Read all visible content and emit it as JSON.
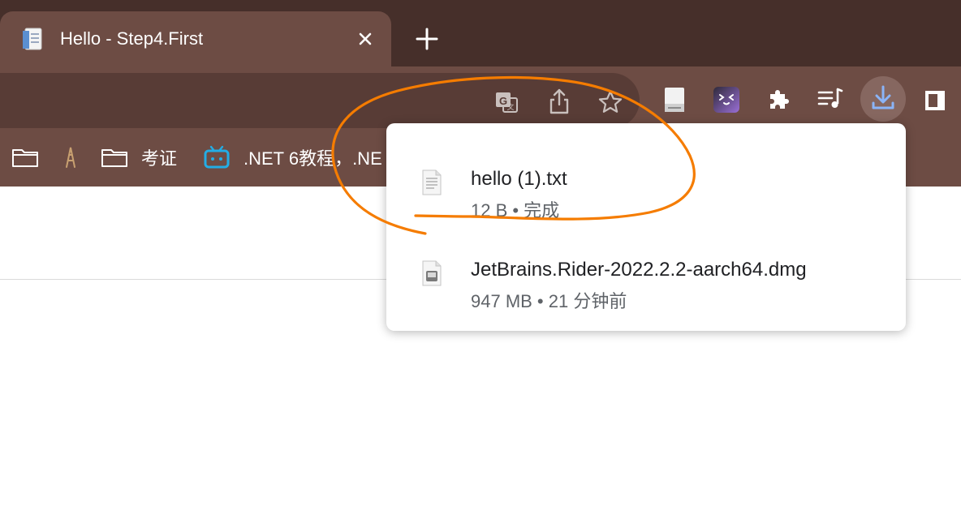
{
  "tab": {
    "title": "Hello - Step4.First",
    "favicon": "document-icon"
  },
  "toolbar": {
    "icons": [
      "translate-icon",
      "share-icon",
      "bookmark-star-icon",
      "extension-document-icon",
      "extension-face-icon",
      "extensions-puzzle-icon",
      "media-control-icon",
      "download-icon",
      "side-panel-icon"
    ]
  },
  "bookmarks": [
    {
      "icon": "folder-icon",
      "label": ""
    },
    {
      "icon": "folder-icon",
      "label": "考证"
    },
    {
      "icon": "bilibili-icon",
      "label": ".NET 6教程，.NE"
    }
  ],
  "downloads": [
    {
      "name": "hello (1).txt",
      "status": "12 B • 完成",
      "icon": "text-file-icon"
    },
    {
      "name": "JetBrains.Rider-2022.2.2-aarch64.dmg",
      "status": "947 MB • 21 分钟前",
      "icon": "disk-image-icon"
    }
  ],
  "colors": {
    "tabstrip": "#462f2a",
    "toolbar": "#6d4c44",
    "omnibox": "#583c36",
    "download_active": "#8ab4f8",
    "annotation": "#f57c00"
  }
}
